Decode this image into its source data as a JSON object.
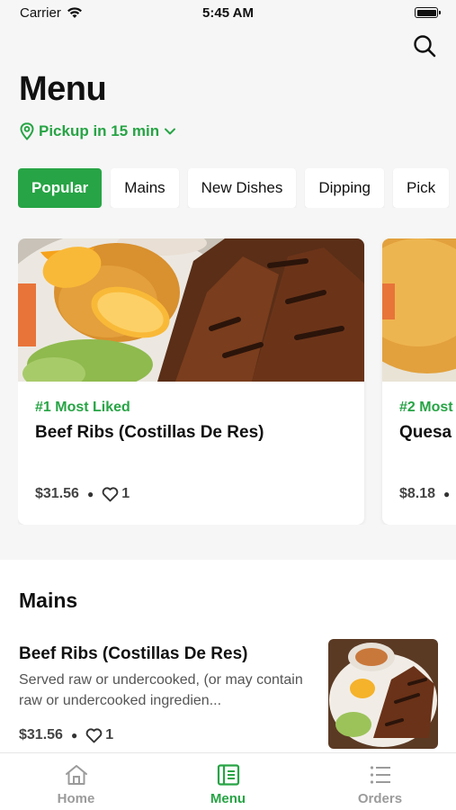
{
  "status_bar": {
    "carrier": "Carrier",
    "time": "5:45 AM"
  },
  "header": {
    "title": "Menu",
    "pickup": "Pickup in 15 min"
  },
  "colors": {
    "accent": "#27a445"
  },
  "tabs": [
    {
      "label": "Popular",
      "active": true
    },
    {
      "label": "Mains",
      "active": false
    },
    {
      "label": "New Dishes",
      "active": false
    },
    {
      "label": "Dipping",
      "active": false
    },
    {
      "label": "Pick",
      "active": false
    }
  ],
  "featured": [
    {
      "rank": "#1 Most Liked",
      "name": "Beef Ribs (Costillas De Res)",
      "price": "$31.56",
      "likes": "1"
    },
    {
      "rank": "#2 Most",
      "name": "Quesa",
      "price": "$8.18",
      "likes": ""
    }
  ],
  "mains": {
    "title": "Mains",
    "items": [
      {
        "name": "Beef Ribs (Costillas De Res)",
        "description": "Served raw or undercooked, (or may contain raw or undercooked ingredien...",
        "price": "$31.56",
        "likes": "1"
      }
    ]
  },
  "tabbar": [
    {
      "label": "Home",
      "icon": "home-icon"
    },
    {
      "label": "Menu",
      "icon": "menu-book-icon",
      "active": true
    },
    {
      "label": "Orders",
      "icon": "list-icon"
    }
  ]
}
